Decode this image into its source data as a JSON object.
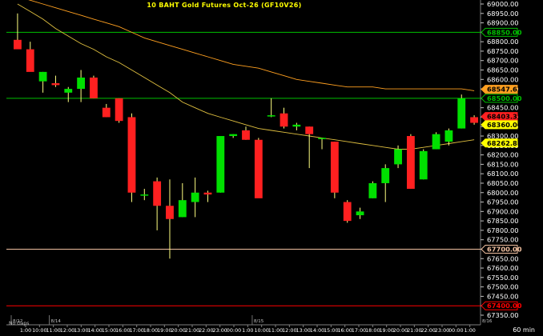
{
  "chart_data": {
    "type": "candlestick",
    "title": "10  BAHT  Gold  Futures  Oct-26  (GF10V26)",
    "timeframe": "60  min",
    "gaps_label": "No  Gaps",
    "ylim": [
      67350,
      69000
    ],
    "yticks": [
      69000,
      68950,
      68900,
      68850,
      68800,
      68750,
      68700,
      68650,
      68600,
      68550,
      68500,
      68450,
      68400,
      68350,
      68300,
      68250,
      68200,
      68150,
      68100,
      68050,
      68000,
      67950,
      67900,
      67850,
      67800,
      67750,
      67700,
      67650,
      67600,
      67550,
      67500,
      67450,
      67400,
      67350
    ],
    "date_labels": [
      {
        "label": "8/12",
        "index": 0
      },
      {
        "label": "8/14",
        "index": 3
      },
      {
        "label": "8/15",
        "index": 19
      },
      {
        "label": "8/16",
        "index": 37
      }
    ],
    "time_labels": [
      "1:00",
      "10:00",
      "11:00",
      "12:00",
      "13:00",
      "14:00",
      "15:00",
      "16:00",
      "17:00",
      "18:00",
      "19:00",
      "20:00",
      "21:00",
      "22:00",
      "23:00",
      "00:00",
      "1:00",
      "10:00",
      "11:00",
      "12:00",
      "13:00",
      "14:00",
      "15:00",
      "16:00",
      "17:00",
      "18:00",
      "19:00",
      "20:00",
      "21:00",
      "22:00",
      "23:00",
      "00:00",
      "1:00"
    ],
    "candles": [
      {
        "o": 68810,
        "h": 68950,
        "l": 68770,
        "c": 68760
      },
      {
        "o": 68760,
        "h": 68800,
        "l": 68650,
        "c": 68640
      },
      {
        "o": 68590,
        "h": 68640,
        "l": 68530,
        "c": 68640
      },
      {
        "o": 68580,
        "h": 68620,
        "l": 68560,
        "c": 68570
      },
      {
        "o": 68530,
        "h": 68560,
        "l": 68480,
        "c": 68550
      },
      {
        "o": 68550,
        "h": 68650,
        "l": 68480,
        "c": 68610
      },
      {
        "o": 68610,
        "h": 68620,
        "l": 68500,
        "c": 68500
      },
      {
        "o": 68450,
        "h": 68470,
        "l": 68400,
        "c": 68400
      },
      {
        "o": 68500,
        "h": 68500,
        "l": 68370,
        "c": 68380
      },
      {
        "o": 68400,
        "h": 68420,
        "l": 67950,
        "c": 68000
      },
      {
        "o": 67990,
        "h": 68020,
        "l": 67960,
        "c": 67990
      },
      {
        "o": 68060,
        "h": 68080,
        "l": 67800,
        "c": 67930
      },
      {
        "o": 67930,
        "h": 68070,
        "l": 67650,
        "c": 67860
      },
      {
        "o": 67870,
        "h": 68050,
        "l": 67870,
        "c": 67960
      },
      {
        "o": 67950,
        "h": 68080,
        "l": 67870,
        "c": 68000
      },
      {
        "o": 68000,
        "h": 68010,
        "l": 67950,
        "c": 67990
      },
      {
        "o": 68000,
        "h": 68250,
        "l": 68000,
        "c": 68300
      },
      {
        "o": 68300,
        "h": 68310,
        "l": 68290,
        "c": 68310
      },
      {
        "o": 68330,
        "h": 68350,
        "l": 68280,
        "c": 68280
      },
      {
        "o": 68280,
        "h": 68290,
        "l": 67980,
        "c": 67970
      },
      {
        "o": 68410,
        "h": 68500,
        "l": 68400,
        "c": 68410
      },
      {
        "o": 68420,
        "h": 68450,
        "l": 68340,
        "c": 68350
      },
      {
        "o": 68350,
        "h": 68370,
        "l": 68330,
        "c": 68360
      },
      {
        "o": 68350,
        "h": 68350,
        "l": 68130,
        "c": 68310
      },
      {
        "o": 68290,
        "h": 68290,
        "l": 68230,
        "c": 68290
      },
      {
        "o": 68270,
        "h": 68270,
        "l": 67970,
        "c": 68000
      },
      {
        "o": 67950,
        "h": 67960,
        "l": 67840,
        "c": 67850
      },
      {
        "o": 67880,
        "h": 67920,
        "l": 67860,
        "c": 67900
      },
      {
        "o": 67970,
        "h": 68060,
        "l": 67970,
        "c": 68050
      },
      {
        "o": 68050,
        "h": 68150,
        "l": 67950,
        "c": 68130
      },
      {
        "o": 68150,
        "h": 68250,
        "l": 68130,
        "c": 68230
      },
      {
        "o": 68300,
        "h": 68310,
        "l": 68020,
        "c": 68020
      },
      {
        "o": 68070,
        "h": 68230,
        "l": 68070,
        "c": 68220
      },
      {
        "o": 68230,
        "h": 68320,
        "l": 68230,
        "c": 68310
      },
      {
        "o": 68270,
        "h": 68340,
        "l": 68250,
        "c": 68330
      },
      {
        "o": 68340,
        "h": 68520,
        "l": 68340,
        "c": 68500
      },
      {
        "o": 68400,
        "h": 68410,
        "l": 68360,
        "c": 68370
      }
    ],
    "ma_fast": [
      69000,
      68960,
      68920,
      68870,
      68830,
      68790,
      68760,
      68720,
      68690,
      68650,
      68610,
      68570,
      68530,
      68480,
      68450,
      68420,
      68400,
      68380,
      68360,
      68340,
      68330,
      68320,
      68310,
      68300,
      68290,
      68280,
      68270,
      68260,
      68250,
      68240,
      68230,
      68230,
      68240,
      68250,
      68260,
      68270,
      68280
    ],
    "ma_slow": [
      69040,
      69020,
      69000,
      68980,
      68960,
      68940,
      68920,
      68900,
      68880,
      68850,
      68820,
      68800,
      68780,
      68760,
      68740,
      68720,
      68700,
      68680,
      68670,
      68660,
      68640,
      68620,
      68600,
      68590,
      68580,
      68570,
      68560,
      68560,
      68560,
      68550,
      68550,
      68550,
      68550,
      68550,
      68550,
      68550,
      68540
    ],
    "ma_fast_color": "#e0c040",
    "ma_slow_color": "#ffa020",
    "up_color": "#00e000",
    "down_color": "#ff2020",
    "hlines": [
      {
        "value": 68850,
        "color": "#00c000",
        "label": "68850.00"
      },
      {
        "value": 68500,
        "color": "#00c000",
        "label": "68500.00"
      },
      {
        "value": 67700,
        "color": "#f0c0a0",
        "label": "67700.00"
      },
      {
        "value": 67400,
        "color": "#ff0000",
        "label": "67400.00"
      }
    ],
    "price_tags": [
      {
        "value": 68547.67,
        "label": "68547.67",
        "bg": "#ffa020",
        "fg": "#000000"
      },
      {
        "value": 68403.35,
        "label": "68403.35",
        "bg": "#ff2020",
        "fg": "#000000"
      },
      {
        "value": 68360.0,
        "label": "68360.00",
        "bg": "#ffff00",
        "fg": "#000000"
      },
      {
        "value": 68262.85,
        "label": "68262.85",
        "bg": "#ffff00",
        "fg": "#000000"
      }
    ]
  }
}
